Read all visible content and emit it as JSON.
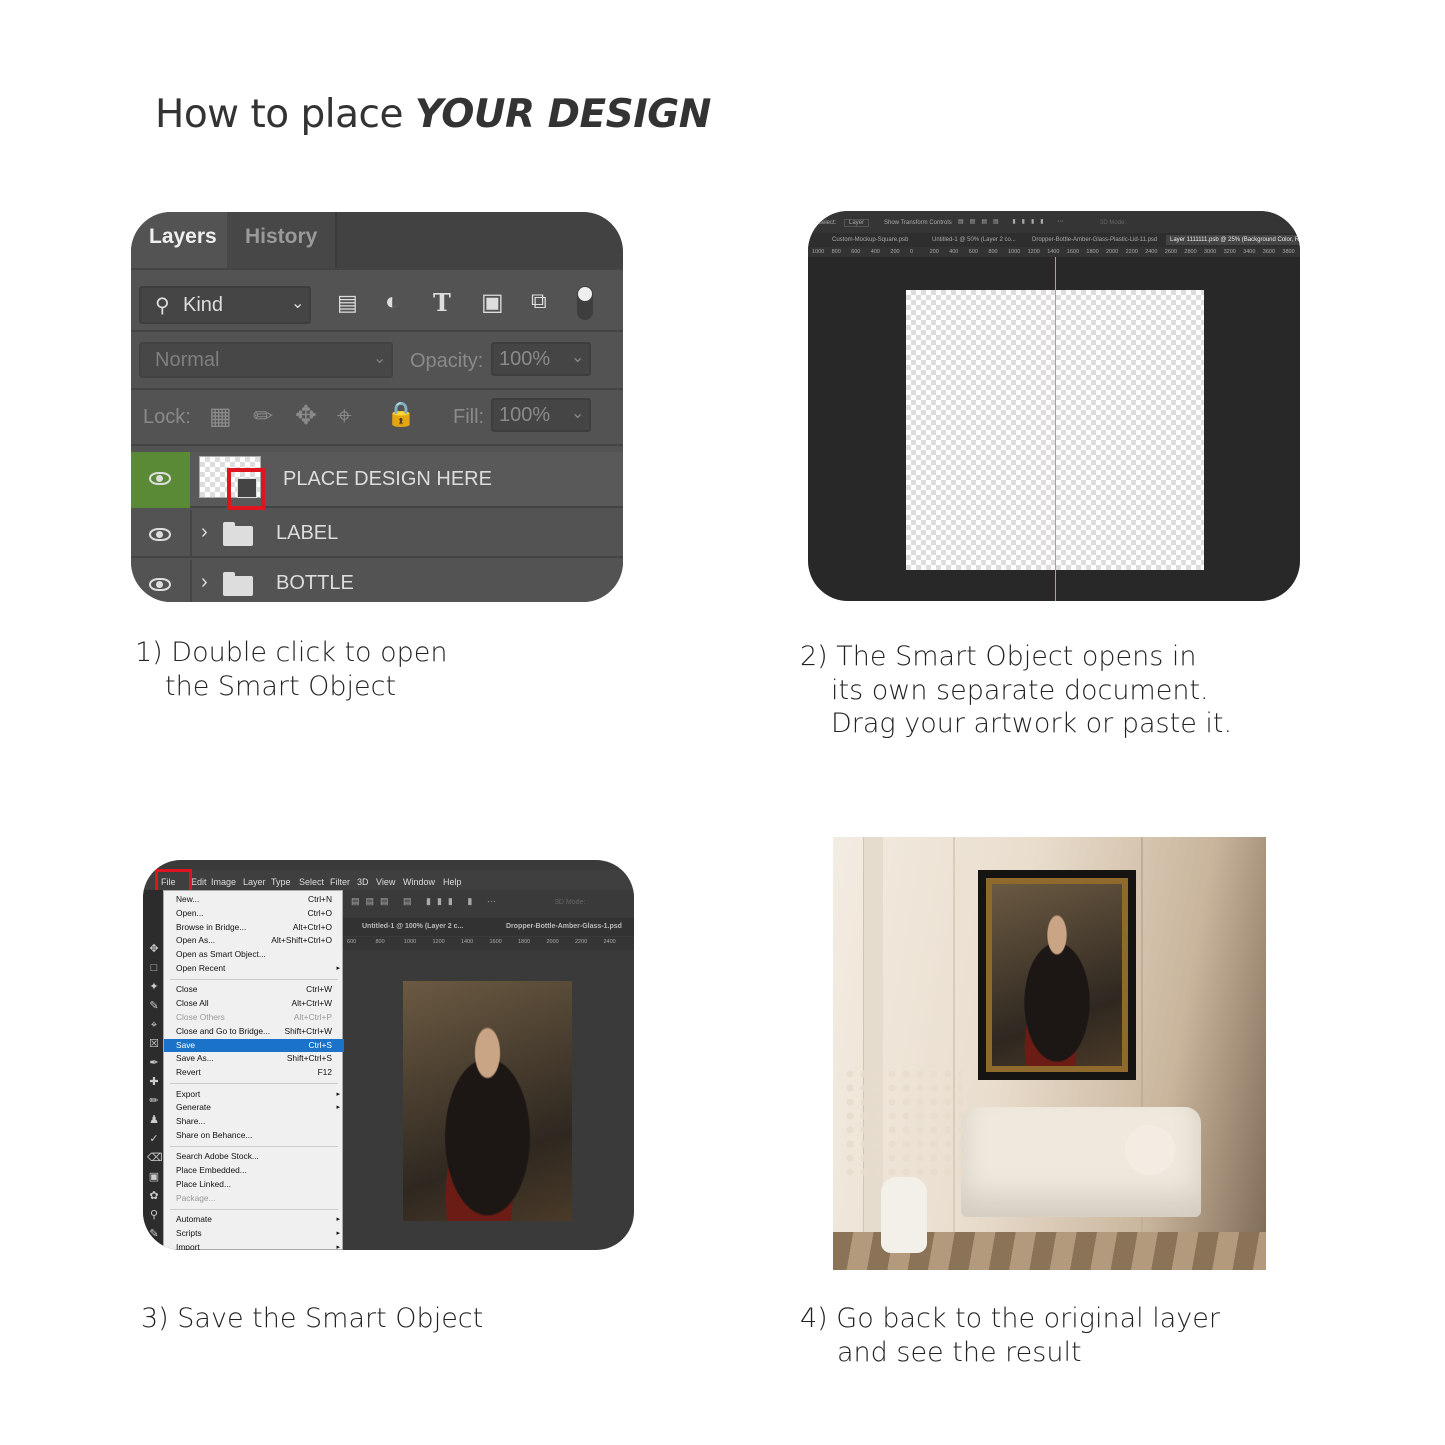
{
  "title": {
    "prefix": "How to place ",
    "emphasis": "YOUR DESIGN"
  },
  "step1": {
    "caption_line1": "1) Double click to open",
    "caption_line2": "the Smart Object",
    "tabs": [
      "Layers",
      "History"
    ],
    "filter_label": "Kind",
    "blend_mode": "Normal",
    "opacity_label": "Opacity:",
    "opacity_value": "100%",
    "lock_label": "Lock:",
    "fill_label": "Fill:",
    "fill_value": "100%",
    "layers": [
      {
        "name": "PLACE DESIGN HERE",
        "selected": true
      },
      {
        "name": "LABEL",
        "type": "group"
      },
      {
        "name": "BOTTLE",
        "type": "group"
      }
    ],
    "colors": {
      "selected_eye": "#5a8a35",
      "highlight": "#e0141e"
    }
  },
  "step2": {
    "caption_line1": "2) The Smart Object opens in",
    "caption_line2": "its own separate document.",
    "caption_line3": "Drag your artwork or paste it.",
    "options": {
      "select_label": "Select:",
      "select_value": "Layer",
      "transform": "Show Transform Controls",
      "mode3d": "3D Mode:"
    },
    "doc_tabs": [
      "Custom-Mockup-Square.psb",
      "Untitled-1 @ 50% (Layer 2 co...",
      "Dropper-Bottle-Amber-Glass-Plastic-Lid-11.psd",
      "Layer 1111111.psb @ 25% (Background Color, RG"
    ],
    "ruler": [
      "1000",
      "800",
      "600",
      "400",
      "200",
      "0",
      "200",
      "400",
      "600",
      "800",
      "1000",
      "1200",
      "1400",
      "1600",
      "1800",
      "2000",
      "2200",
      "2400",
      "2600",
      "2800",
      "3000",
      "3200",
      "3400",
      "3600",
      "3800"
    ]
  },
  "step3": {
    "caption": "3) Save the Smart Object",
    "menubar": [
      "File",
      "Edit",
      "Image",
      "Layer",
      "Type",
      "Select",
      "Filter",
      "3D",
      "View",
      "Window",
      "Help"
    ],
    "doc_tabs": [
      "Untitled-1 @ 100% (Layer 2 c...",
      "Dropper-Bottle-Amber-Glass-1.psd"
    ],
    "ruler": [
      "600",
      "800",
      "1000",
      "1200",
      "1400",
      "1600",
      "1800",
      "2000",
      "2200",
      "2400"
    ],
    "mode3d": "3D Mode:",
    "menu": [
      {
        "label": "New...",
        "shortcut": "Ctrl+N"
      },
      {
        "label": "Open...",
        "shortcut": "Ctrl+O"
      },
      {
        "label": "Browse in Bridge...",
        "shortcut": "Alt+Ctrl+O"
      },
      {
        "label": "Open As...",
        "shortcut": "Alt+Shift+Ctrl+O"
      },
      {
        "label": "Open as Smart Object..."
      },
      {
        "label": "Open Recent",
        "submenu": true
      },
      {
        "sep": true
      },
      {
        "label": "Close",
        "shortcut": "Ctrl+W"
      },
      {
        "label": "Close All",
        "shortcut": "Alt+Ctrl+W"
      },
      {
        "label": "Close Others",
        "shortcut": "Alt+Ctrl+P",
        "disabled": true
      },
      {
        "label": "Close and Go to Bridge...",
        "shortcut": "Shift+Ctrl+W"
      },
      {
        "label": "Save",
        "shortcut": "Ctrl+S",
        "highlighted": true
      },
      {
        "label": "Save As...",
        "shortcut": "Shift+Ctrl+S"
      },
      {
        "label": "Revert",
        "shortcut": "F12"
      },
      {
        "sep": true
      },
      {
        "label": "Export",
        "submenu": true
      },
      {
        "label": "Generate",
        "submenu": true
      },
      {
        "label": "Share..."
      },
      {
        "label": "Share on Behance..."
      },
      {
        "sep": true
      },
      {
        "label": "Search Adobe Stock..."
      },
      {
        "label": "Place Embedded..."
      },
      {
        "label": "Place Linked..."
      },
      {
        "label": "Package...",
        "disabled": true
      },
      {
        "sep": true
      },
      {
        "label": "Automate",
        "submenu": true
      },
      {
        "label": "Scripts",
        "submenu": true
      },
      {
        "label": "Import",
        "submenu": true
      }
    ]
  },
  "step4": {
    "caption_line1": "4) Go back to the original layer",
    "caption_line2": "and see the result"
  }
}
